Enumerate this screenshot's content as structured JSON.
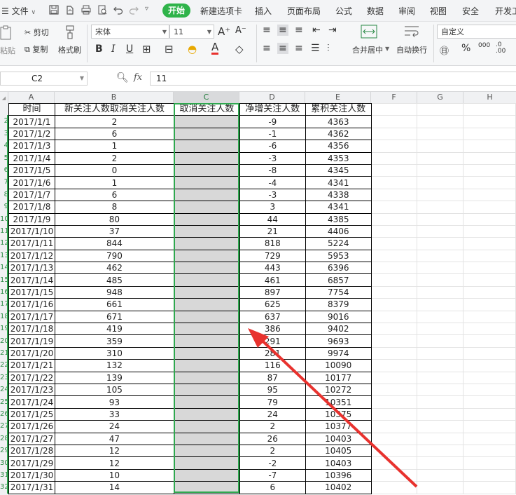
{
  "menubar": {
    "file_label": "文件",
    "tabs": [
      "开始",
      "新建选项卡",
      "插入",
      "页面布局",
      "公式",
      "数据",
      "审阅",
      "视图",
      "安全",
      "开发工"
    ]
  },
  "ribbon": {
    "cut": "剪切",
    "paste_partial": "粘贴",
    "copy": "复制",
    "format_painter": "格式刷",
    "font_name": "宋体",
    "font_size": "11",
    "merge_center": "合并居中",
    "auto_wrap": "自动换行",
    "number_format": "自定义",
    "percent": "%",
    "thousands": "000"
  },
  "formula_bar": {
    "name_box": "C2",
    "fx": "fx",
    "value": "11"
  },
  "columns": [
    "A",
    "B",
    "C",
    "D",
    "E",
    "F",
    "G",
    "H"
  ],
  "row_numbers": [
    "",
    "2",
    "3",
    "4",
    "5",
    "6",
    "7",
    "8",
    "9",
    "10",
    "11",
    "12",
    "13",
    "14",
    "15",
    "16",
    "17",
    "18",
    "19",
    "20",
    "21",
    "22",
    "23",
    "24",
    "25",
    "26",
    "27",
    "28",
    "29",
    "30",
    "31",
    "32"
  ],
  "table": {
    "headers": [
      "时间",
      "新关注人数",
      "取消关注人数",
      "净增关注人数",
      "累积关注人数"
    ],
    "rows": [
      [
        "2017/1/1",
        "2",
        "-9",
        "4363"
      ],
      [
        "2017/1/2",
        "6",
        "-1",
        "4362"
      ],
      [
        "2017/1/3",
        "1",
        "-6",
        "4356"
      ],
      [
        "2017/1/4",
        "2",
        "-3",
        "4353"
      ],
      [
        "2017/1/5",
        "0",
        "-8",
        "4345"
      ],
      [
        "2017/1/6",
        "1",
        "-4",
        "4341"
      ],
      [
        "2017/1/7",
        "6",
        "-3",
        "4338"
      ],
      [
        "2017/1/8",
        "8",
        "3",
        "4341"
      ],
      [
        "2017/1/9",
        "80",
        "44",
        "4385"
      ],
      [
        "2017/1/10",
        "37",
        "21",
        "4406"
      ],
      [
        "2017/1/11",
        "844",
        "818",
        "5224"
      ],
      [
        "2017/1/12",
        "790",
        "729",
        "5953"
      ],
      [
        "2017/1/13",
        "462",
        "443",
        "6396"
      ],
      [
        "2017/1/14",
        "485",
        "461",
        "6857"
      ],
      [
        "2017/1/15",
        "948",
        "897",
        "7754"
      ],
      [
        "2017/1/16",
        "661",
        "625",
        "8379"
      ],
      [
        "2017/1/17",
        "671",
        "637",
        "9016"
      ],
      [
        "2017/1/18",
        "419",
        "386",
        "9402"
      ],
      [
        "2017/1/19",
        "359",
        "291",
        "9693"
      ],
      [
        "2017/1/20",
        "310",
        "281",
        "9974"
      ],
      [
        "2017/1/21",
        "132",
        "116",
        "10090"
      ],
      [
        "2017/1/22",
        "139",
        "87",
        "10177"
      ],
      [
        "2017/1/23",
        "105",
        "95",
        "10272"
      ],
      [
        "2017/1/24",
        "93",
        "79",
        "10351"
      ],
      [
        "2017/1/25",
        "33",
        "24",
        "10375"
      ],
      [
        "2017/1/26",
        "24",
        "2",
        "10377"
      ],
      [
        "2017/1/27",
        "47",
        "26",
        "10403"
      ],
      [
        "2017/1/28",
        "12",
        "2",
        "10405"
      ],
      [
        "2017/1/29",
        "12",
        "-2",
        "10403"
      ],
      [
        "2017/1/30",
        "10",
        "-7",
        "10396"
      ],
      [
        "2017/1/31",
        "14",
        "6",
        "10402"
      ]
    ]
  },
  "colors": {
    "accent_green": "#2fb34a",
    "selection_outline": "#2fa84f",
    "annotation_arrow": "#e8322e",
    "selected_fill": "#d8d8d8"
  }
}
